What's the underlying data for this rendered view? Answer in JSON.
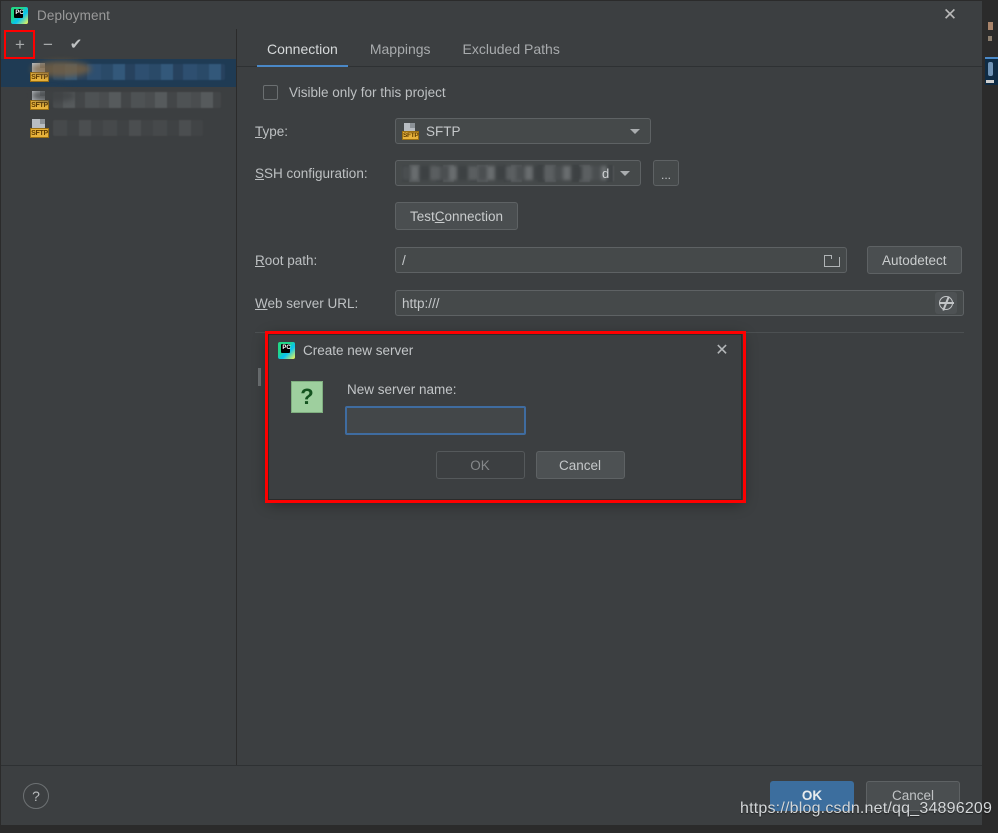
{
  "window": {
    "title": "Deployment",
    "logo_icon": "pycharm-logo-icon",
    "close_icon": "close-icon"
  },
  "left_panel": {
    "toolbar": {
      "add_label": "+",
      "add_icon": "plus-icon",
      "remove_label": "−",
      "remove_icon": "minus-icon",
      "default_label": "✔",
      "default_icon": "check-icon",
      "highlight_color": "#fe0000"
    },
    "servers": [
      {
        "name": "",
        "type_badge": "SFTP",
        "selected": true
      },
      {
        "name": "",
        "type_badge": "SFTP",
        "selected": false
      },
      {
        "name": "",
        "type_badge": "SFTP",
        "selected": false
      }
    ]
  },
  "tabs": [
    {
      "label": "Connection",
      "active": true
    },
    {
      "label": "Mappings",
      "active": false
    },
    {
      "label": "Excluded Paths",
      "active": false
    }
  ],
  "form": {
    "visible_only_checkbox": {
      "label": "Visible only for this project",
      "checked": false
    },
    "type": {
      "label": "Type:",
      "value": "SFTP",
      "badge": "SFTP",
      "dropdown_icon": "chevron-down-icon"
    },
    "ssh_configuration": {
      "label": "SSH configuration:",
      "value": "",
      "browse_label": "...",
      "dropdown_icon": "chevron-down-icon"
    },
    "test_connection_label": "Test Connection",
    "root_path": {
      "label": "Root path:",
      "value": "/",
      "folder_icon": "folder-icon"
    },
    "autodetect_label": "Autodetect",
    "web_server_url": {
      "label": "Web server URL:",
      "value": "http:///",
      "globe_icon": "globe-icon"
    }
  },
  "bottom_bar": {
    "help_label": "?",
    "help_icon": "help-icon",
    "ok_label": "OK",
    "cancel_label": "Cancel",
    "ok_color": "#3c6e9e"
  },
  "modal": {
    "title": "Create new server",
    "logo_icon": "pycharm-logo-icon",
    "close_icon": "close-icon",
    "question_icon": "question-mark-icon",
    "question_glyph": "?",
    "field_label": "New server name:",
    "field_value": "",
    "field_placeholder": "",
    "ok_label": "OK",
    "ok_enabled": false,
    "cancel_label": "Cancel",
    "highlight_color": "#fe0000"
  },
  "watermark": {
    "text": "https://blog.csdn.net/qq_34896209"
  }
}
